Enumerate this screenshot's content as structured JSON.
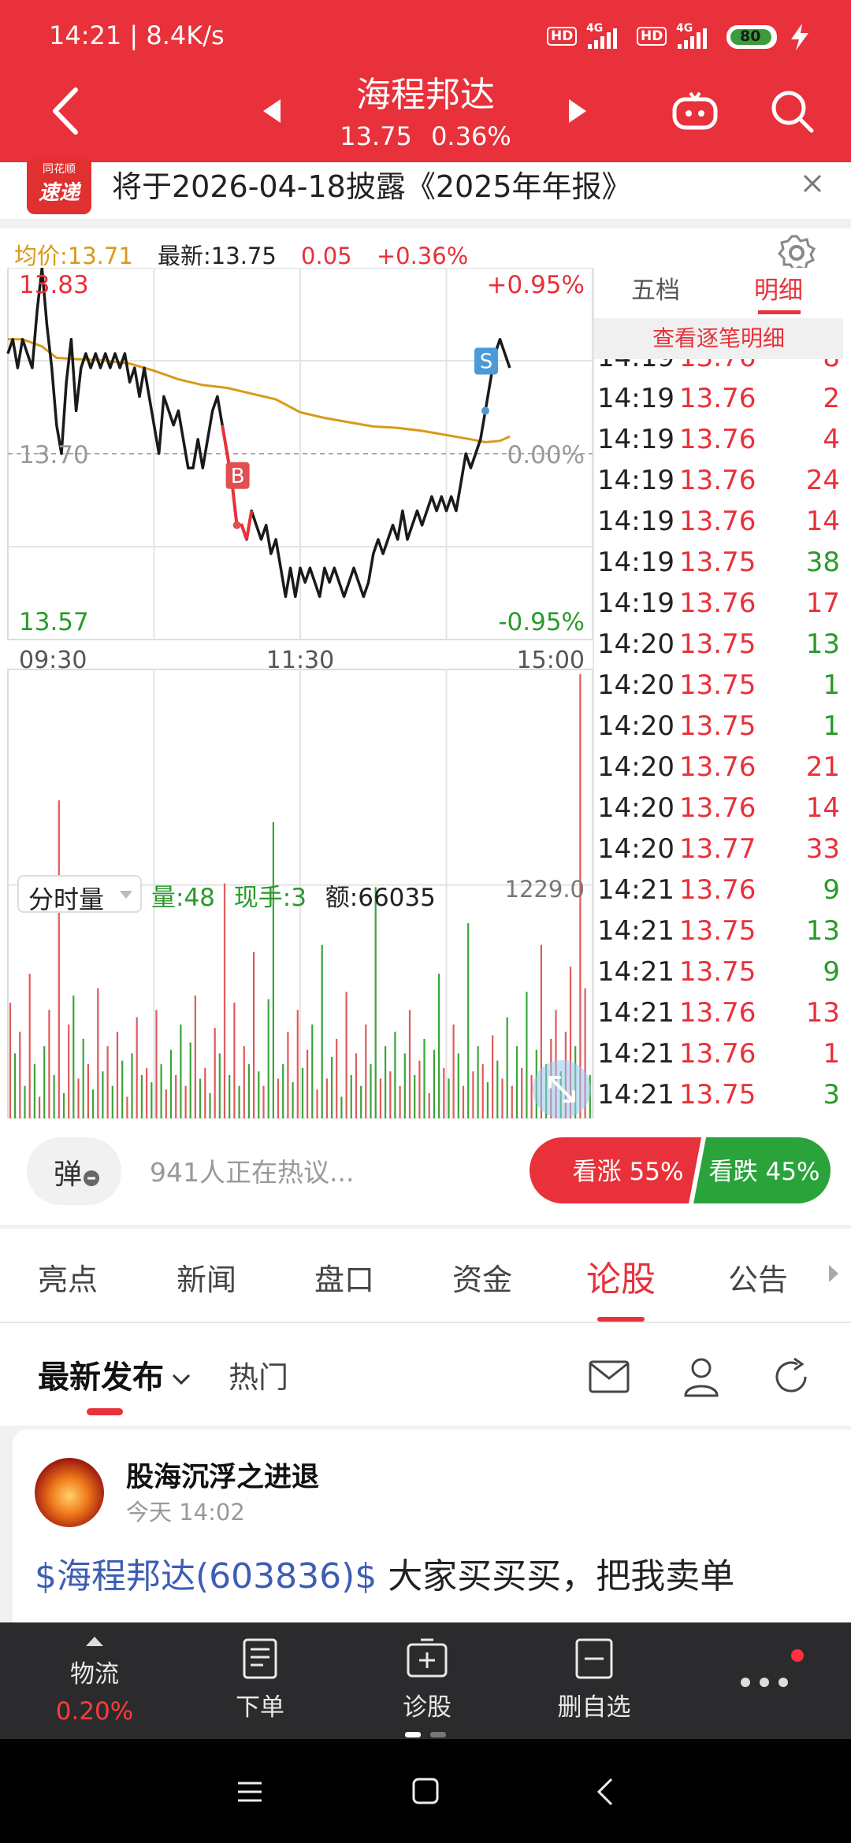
{
  "status_bar": {
    "time_speed": "14:21 | 8.4K/s",
    "hd1": "HD",
    "hd2": "HD",
    "net1": "4G",
    "net2": "4G",
    "battery": "80"
  },
  "header": {
    "stock_name": "海程邦达",
    "price": "13.75",
    "change_pct": "0.36%"
  },
  "notice": {
    "logo_top": "同花顺",
    "logo_bottom": "速递",
    "text": "将于2026-04-18披露《2025年年报》"
  },
  "quote": {
    "avg_label": "均价:13.71",
    "latest_label": "最新:13.75",
    "change": "0.05",
    "change_pct": "+0.36%"
  },
  "chart_data": {
    "type": "line",
    "title": "",
    "y_max_label": "13.83",
    "y_mid_label": "13.70",
    "y_min_label": "13.57",
    "pct_max_label": "+0.95%",
    "pct_mid_label": "0.00%",
    "pct_min_label": "-0.95%",
    "x_ticks": [
      "09:30",
      "11:30",
      "15:00"
    ],
    "ylim": [
      13.57,
      13.83
    ],
    "prev_close": 13.7,
    "price_series": {
      "name": "最新",
      "points": [
        [
          0,
          13.77
        ],
        [
          2,
          13.78
        ],
        [
          4,
          13.76
        ],
        [
          6,
          13.78
        ],
        [
          8,
          13.77
        ],
        [
          10,
          13.76
        ],
        [
          12,
          13.8
        ],
        [
          14,
          13.83
        ],
        [
          16,
          13.79
        ],
        [
          18,
          13.76
        ],
        [
          20,
          13.72
        ],
        [
          22,
          13.7
        ],
        [
          24,
          13.75
        ],
        [
          26,
          13.78
        ],
        [
          28,
          13.73
        ],
        [
          30,
          13.76
        ],
        [
          32,
          13.77
        ],
        [
          34,
          13.76
        ],
        [
          36,
          13.77
        ],
        [
          38,
          13.76
        ],
        [
          40,
          13.77
        ],
        [
          42,
          13.76
        ],
        [
          44,
          13.77
        ],
        [
          46,
          13.76
        ],
        [
          48,
          13.77
        ],
        [
          50,
          13.75
        ],
        [
          52,
          13.76
        ],
        [
          54,
          13.74
        ],
        [
          56,
          13.76
        ],
        [
          58,
          13.74
        ],
        [
          60,
          13.72
        ],
        [
          62,
          13.7
        ],
        [
          64,
          13.74
        ],
        [
          66,
          13.73
        ],
        [
          68,
          13.72
        ],
        [
          70,
          13.73
        ],
        [
          72,
          13.71
        ],
        [
          74,
          13.69
        ],
        [
          76,
          13.69
        ],
        [
          78,
          13.71
        ],
        [
          80,
          13.69
        ],
        [
          82,
          13.71
        ],
        [
          84,
          13.73
        ],
        [
          86,
          13.74
        ],
        [
          88,
          13.72
        ],
        [
          90,
          13.7
        ],
        [
          92,
          13.68
        ],
        [
          94,
          13.65
        ],
        [
          96,
          13.65
        ],
        [
          98,
          13.64
        ],
        [
          100,
          13.66
        ],
        [
          102,
          13.65
        ],
        [
          104,
          13.64
        ],
        [
          106,
          13.65
        ],
        [
          108,
          13.63
        ],
        [
          110,
          13.64
        ],
        [
          112,
          13.62
        ],
        [
          114,
          13.6
        ],
        [
          116,
          13.62
        ],
        [
          118,
          13.6
        ],
        [
          120,
          13.62
        ],
        [
          122,
          13.61
        ],
        [
          124,
          13.62
        ],
        [
          126,
          13.61
        ],
        [
          128,
          13.6
        ],
        [
          130,
          13.62
        ],
        [
          132,
          13.61
        ],
        [
          134,
          13.62
        ],
        [
          136,
          13.61
        ],
        [
          138,
          13.6
        ],
        [
          140,
          13.61
        ],
        [
          142,
          13.62
        ],
        [
          144,
          13.61
        ],
        [
          146,
          13.6
        ],
        [
          148,
          13.61
        ],
        [
          150,
          13.63
        ],
        [
          152,
          13.64
        ],
        [
          154,
          13.63
        ],
        [
          156,
          13.64
        ],
        [
          158,
          13.65
        ],
        [
          160,
          13.64
        ],
        [
          162,
          13.66
        ],
        [
          164,
          13.64
        ],
        [
          166,
          13.65
        ],
        [
          168,
          13.66
        ],
        [
          170,
          13.65
        ],
        [
          172,
          13.66
        ],
        [
          174,
          13.67
        ],
        [
          176,
          13.66
        ],
        [
          178,
          13.67
        ],
        [
          180,
          13.66
        ],
        [
          182,
          13.67
        ],
        [
          184,
          13.66
        ],
        [
          186,
          13.68
        ],
        [
          188,
          13.7
        ],
        [
          190,
          13.69
        ],
        [
          192,
          13.7
        ],
        [
          194,
          13.71
        ],
        [
          196,
          13.73
        ],
        [
          198,
          13.75
        ],
        [
          200,
          13.77
        ],
        [
          202,
          13.78
        ],
        [
          204,
          13.77
        ],
        [
          206,
          13.76
        ]
      ]
    },
    "avg_series": {
      "name": "均价",
      "points": [
        [
          0,
          13.78
        ],
        [
          6,
          13.78
        ],
        [
          14,
          13.775
        ],
        [
          20,
          13.767
        ],
        [
          30,
          13.766
        ],
        [
          40,
          13.765
        ],
        [
          50,
          13.763
        ],
        [
          60,
          13.758
        ],
        [
          70,
          13.752
        ],
        [
          80,
          13.748
        ],
        [
          90,
          13.746
        ],
        [
          100,
          13.742
        ],
        [
          110,
          13.738
        ],
        [
          120,
          13.729
        ],
        [
          130,
          13.725
        ],
        [
          140,
          13.722
        ],
        [
          150,
          13.719
        ],
        [
          160,
          13.718
        ],
        [
          170,
          13.716
        ],
        [
          180,
          13.713
        ],
        [
          190,
          13.71
        ],
        [
          196,
          13.708
        ],
        [
          202,
          13.709
        ],
        [
          206,
          13.712
        ]
      ]
    },
    "time_axis": {
      "start": 0,
      "end": 240,
      "midday": 120
    },
    "markers": [
      {
        "label": "B",
        "x": 94,
        "price": 13.65
      },
      {
        "label": "S",
        "x": 196,
        "price": 13.73
      }
    ],
    "volume": {
      "max_label": "1229.0",
      "selector": "分时量",
      "vol_label": "量:48",
      "hand_label": "现手:3",
      "amount_label": "额:66035",
      "max": 1229,
      "bars": [
        {
          "v": 320,
          "c": "r"
        },
        {
          "v": 180,
          "c": "g"
        },
        {
          "v": 240,
          "c": "r"
        },
        {
          "v": 90,
          "c": "g"
        },
        {
          "v": 400,
          "c": "r"
        },
        {
          "v": 150,
          "c": "g"
        },
        {
          "v": 60,
          "c": "r"
        },
        {
          "v": 200,
          "c": "g"
        },
        {
          "v": 300,
          "c": "r"
        },
        {
          "v": 120,
          "c": "g"
        },
        {
          "v": 880,
          "c": "r"
        },
        {
          "v": 70,
          "c": "g"
        },
        {
          "v": 260,
          "c": "r"
        },
        {
          "v": 340,
          "c": "g"
        },
        {
          "v": 110,
          "c": "r"
        },
        {
          "v": 220,
          "c": "g"
        },
        {
          "v": 150,
          "c": "r"
        },
        {
          "v": 80,
          "c": "g"
        },
        {
          "v": 360,
          "c": "r"
        },
        {
          "v": 130,
          "c": "g"
        },
        {
          "v": 200,
          "c": "r"
        },
        {
          "v": 90,
          "c": "g"
        },
        {
          "v": 240,
          "c": "r"
        },
        {
          "v": 160,
          "c": "g"
        },
        {
          "v": 60,
          "c": "r"
        },
        {
          "v": 180,
          "c": "g"
        },
        {
          "v": 280,
          "c": "r"
        },
        {
          "v": 120,
          "c": "g"
        },
        {
          "v": 140,
          "c": "r"
        },
        {
          "v": 100,
          "c": "g"
        },
        {
          "v": 300,
          "c": "r"
        },
        {
          "v": 150,
          "c": "g"
        },
        {
          "v": 80,
          "c": "r"
        },
        {
          "v": 190,
          "c": "g"
        },
        {
          "v": 120,
          "c": "r"
        },
        {
          "v": 260,
          "c": "g"
        },
        {
          "v": 90,
          "c": "r"
        },
        {
          "v": 210,
          "c": "g"
        },
        {
          "v": 340,
          "c": "r"
        },
        {
          "v": 110,
          "c": "g"
        },
        {
          "v": 140,
          "c": "r"
        },
        {
          "v": 70,
          "c": "g"
        },
        {
          "v": 250,
          "c": "r"
        },
        {
          "v": 180,
          "c": "g"
        },
        {
          "v": 650,
          "c": "r"
        },
        {
          "v": 120,
          "c": "g"
        },
        {
          "v": 320,
          "c": "r"
        },
        {
          "v": 90,
          "c": "g"
        },
        {
          "v": 200,
          "c": "r"
        },
        {
          "v": 150,
          "c": "g"
        },
        {
          "v": 460,
          "c": "r"
        },
        {
          "v": 130,
          "c": "g"
        },
        {
          "v": 90,
          "c": "r"
        },
        {
          "v": 330,
          "c": "g"
        },
        {
          "v": 820,
          "c": "g"
        },
        {
          "v": 110,
          "c": "r"
        },
        {
          "v": 150,
          "c": "g"
        },
        {
          "v": 240,
          "c": "r"
        },
        {
          "v": 100,
          "c": "g"
        },
        {
          "v": 300,
          "c": "r"
        },
        {
          "v": 140,
          "c": "g"
        },
        {
          "v": 190,
          "c": "r"
        },
        {
          "v": 260,
          "c": "g"
        },
        {
          "v": 80,
          "c": "r"
        },
        {
          "v": 480,
          "c": "g"
        },
        {
          "v": 110,
          "c": "r"
        },
        {
          "v": 170,
          "c": "g"
        },
        {
          "v": 220,
          "c": "r"
        },
        {
          "v": 60,
          "c": "g"
        },
        {
          "v": 350,
          "c": "r"
        },
        {
          "v": 120,
          "c": "g"
        },
        {
          "v": 180,
          "c": "r"
        },
        {
          "v": 90,
          "c": "g"
        },
        {
          "v": 260,
          "c": "r"
        },
        {
          "v": 150,
          "c": "g"
        },
        {
          "v": 640,
          "c": "g"
        },
        {
          "v": 110,
          "c": "r"
        },
        {
          "v": 200,
          "c": "g"
        },
        {
          "v": 130,
          "c": "r"
        },
        {
          "v": 240,
          "c": "g"
        },
        {
          "v": 90,
          "c": "r"
        },
        {
          "v": 180,
          "c": "g"
        },
        {
          "v": 300,
          "c": "r"
        },
        {
          "v": 120,
          "c": "g"
        },
        {
          "v": 160,
          "c": "r"
        },
        {
          "v": 220,
          "c": "g"
        },
        {
          "v": 70,
          "c": "r"
        },
        {
          "v": 190,
          "c": "g"
        },
        {
          "v": 400,
          "c": "g"
        },
        {
          "v": 140,
          "c": "r"
        },
        {
          "v": 110,
          "c": "g"
        },
        {
          "v": 260,
          "c": "r"
        },
        {
          "v": 180,
          "c": "g"
        },
        {
          "v": 90,
          "c": "r"
        },
        {
          "v": 540,
          "c": "g"
        },
        {
          "v": 130,
          "c": "r"
        },
        {
          "v": 200,
          "c": "g"
        },
        {
          "v": 150,
          "c": "r"
        },
        {
          "v": 100,
          "c": "g"
        },
        {
          "v": 230,
          "c": "r"
        },
        {
          "v": 160,
          "c": "g"
        },
        {
          "v": 110,
          "c": "r"
        },
        {
          "v": 280,
          "c": "g"
        },
        {
          "v": 90,
          "c": "r"
        },
        {
          "v": 200,
          "c": "g"
        },
        {
          "v": 140,
          "c": "r"
        },
        {
          "v": 350,
          "c": "g"
        },
        {
          "v": 120,
          "c": "r"
        },
        {
          "v": 190,
          "c": "g"
        },
        {
          "v": 480,
          "c": "r"
        },
        {
          "v": 150,
          "c": "g"
        },
        {
          "v": 220,
          "c": "r"
        },
        {
          "v": 300,
          "c": "r"
        },
        {
          "v": 130,
          "c": "g"
        },
        {
          "v": 240,
          "c": "r"
        },
        {
          "v": 420,
          "c": "r"
        },
        {
          "v": 200,
          "c": "g"
        },
        {
          "v": 1229,
          "c": "r"
        },
        {
          "v": 360,
          "c": "r"
        },
        {
          "v": 120,
          "c": "g"
        }
      ]
    }
  },
  "side_panel": {
    "tab_wudang": "五档",
    "tab_mingxi": "明细",
    "detail_button": "查看逐笔明细",
    "rows": [
      {
        "time": "14:19",
        "price": "13.76",
        "vol": "2",
        "vc": "r"
      },
      {
        "time": "14:19",
        "price": "13.76",
        "vol": "4",
        "vc": "r"
      },
      {
        "time": "14:19",
        "price": "13.76",
        "vol": "24",
        "vc": "r"
      },
      {
        "time": "14:19",
        "price": "13.76",
        "vol": "14",
        "vc": "r"
      },
      {
        "time": "14:19",
        "price": "13.75",
        "vol": "38",
        "vc": "g"
      },
      {
        "time": "14:19",
        "price": "13.76",
        "vol": "17",
        "vc": "r"
      },
      {
        "time": "14:20",
        "price": "13.75",
        "vol": "13",
        "vc": "g"
      },
      {
        "time": "14:20",
        "price": "13.75",
        "vol": "1",
        "vc": "g"
      },
      {
        "time": "14:20",
        "price": "13.75",
        "vol": "1",
        "vc": "g"
      },
      {
        "time": "14:20",
        "price": "13.76",
        "vol": "21",
        "vc": "r"
      },
      {
        "time": "14:20",
        "price": "13.76",
        "vol": "14",
        "vc": "r"
      },
      {
        "time": "14:20",
        "price": "13.77",
        "vol": "33",
        "vc": "r"
      },
      {
        "time": "14:21",
        "price": "13.76",
        "vol": "9",
        "vc": "g"
      },
      {
        "time": "14:21",
        "price": "13.75",
        "vol": "13",
        "vc": "g"
      },
      {
        "time": "14:21",
        "price": "13.75",
        "vol": "9",
        "vc": "g"
      },
      {
        "time": "14:21",
        "price": "13.76",
        "vol": "13",
        "vc": "r"
      },
      {
        "time": "14:21",
        "price": "13.76",
        "vol": "1",
        "vc": "r"
      },
      {
        "time": "14:21",
        "price": "13.75",
        "vol": "3",
        "vc": "g"
      }
    ]
  },
  "sentiment": {
    "danmu": "弹",
    "discuss": "941人正在热议...",
    "up": "看涨 55%",
    "down": "看跌 45%",
    "up_ratio": 0.55
  },
  "tabs": {
    "items": [
      "亮点",
      "新闻",
      "盘口",
      "资金",
      "论股",
      "公告"
    ],
    "active": 4
  },
  "subtabs": {
    "latest": "最新发布",
    "hot": "热门"
  },
  "post": {
    "author": "股海沉浮之进退",
    "time": "今天 14:02",
    "link": "$海程邦达(603836)$",
    "content": " 大家买买买，把我卖单"
  },
  "bottom_nav": {
    "wuliu": "物流",
    "wuliu_pct": "0.20%",
    "order": "下单",
    "diagnose": "诊股",
    "remove": "删自选"
  },
  "colors": {
    "red": "#e8313a",
    "green": "#2a9a2a",
    "gold": "#d99a1a",
    "blue": "#3d5db5"
  }
}
